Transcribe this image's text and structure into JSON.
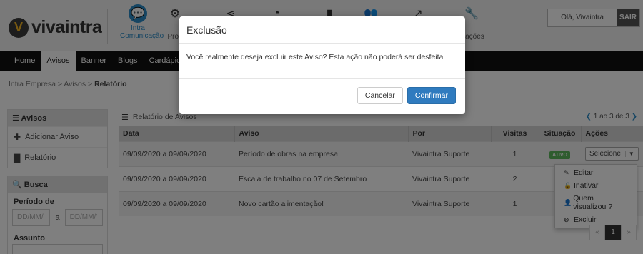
{
  "brand": {
    "logo_letter": "V",
    "logo_text": "vivaintra"
  },
  "modules": [
    {
      "icon": "💬",
      "line1": "Intra",
      "line2": "Comunicação"
    },
    {
      "icon": "⚙",
      "line1": "",
      "line2": "Prod"
    },
    {
      "icon": "⋖",
      "line1": "",
      "line2": ""
    },
    {
      "icon": "◔",
      "line1": "",
      "line2": ""
    },
    {
      "icon": "▮",
      "line1": "",
      "line2": ""
    },
    {
      "icon": "👥",
      "line1": "",
      "line2": ""
    },
    {
      "icon": "↗",
      "line1": "",
      "line2": ""
    },
    {
      "icon": "🔧",
      "line1": "",
      "line2": "urações"
    }
  ],
  "user": {
    "greeting": "Olá, Vivaintra",
    "logout": "SAIR"
  },
  "nav": [
    "Home",
    "Avisos",
    "Banner",
    "Blogs",
    "Cardápio"
  ],
  "breadcrumb": {
    "part1": "Intra Empresa",
    "part2": "Avisos",
    "current": "Relatório",
    "sep": " > "
  },
  "sidebar": {
    "avisos_title": "Avisos",
    "add_label": "Adicionar Aviso",
    "report_label": "Relatório",
    "search_title": "Busca",
    "period_label": "Período de",
    "date_placeholder": "DD/MM/",
    "date_placeholder2": "DD/MM/'",
    "date_sep": "a",
    "subject_label": "Assunto"
  },
  "main": {
    "title": "Relatório de Avisos",
    "pager_text": "1 ao 3 de 3",
    "columns": [
      "Data",
      "Aviso",
      "Por",
      "Visitas",
      "Situação",
      "Ações"
    ],
    "rows": [
      {
        "data": "09/09/2020 a 09/09/2020",
        "aviso": "Período de obras na empresa",
        "por": "Vivaintra Suporte",
        "visitas": "1",
        "situacao": "ATIVO"
      },
      {
        "data": "09/09/2020 a 09/09/2020",
        "aviso": "Escala de trabalho no 07 de Setembro",
        "por": "Vivaintra Suporte",
        "visitas": "2",
        "situacao": "A"
      },
      {
        "data": "09/09/2020 a 09/09/2020",
        "aviso": "Novo cartão alimentação!",
        "por": "Vivaintra Suporte",
        "visitas": "1",
        "situacao": "A"
      }
    ],
    "select_label": "Selecione",
    "menu": [
      "Editar",
      "Inativar",
      "Quem visualizou ?",
      "Excluir"
    ],
    "pager_prev": "«",
    "pager_page": "1",
    "pager_next": "»"
  },
  "modal": {
    "title": "Exclusão",
    "message": "Você realmente deseja excluir este Aviso? Esta ação não poderá ser desfeita",
    "cancel": "Cancelar",
    "confirm": "Confirmar"
  }
}
